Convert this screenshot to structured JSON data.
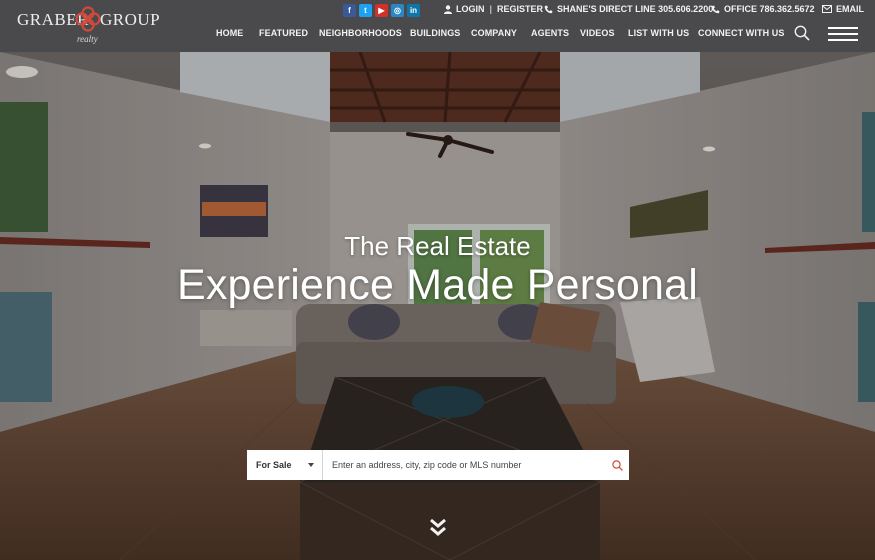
{
  "brand": {
    "left_word": "GRABER",
    "right_word": "GROUP",
    "tagline": "realty",
    "mark_color": "#d04a3b"
  },
  "social": [
    {
      "name": "facebook",
      "glyph": "f"
    },
    {
      "name": "twitter",
      "glyph": "t"
    },
    {
      "name": "youtube",
      "glyph": "▶"
    },
    {
      "name": "instagram",
      "glyph": "◎"
    },
    {
      "name": "linkedin",
      "glyph": "in"
    }
  ],
  "utility": {
    "login": "LOGIN",
    "register": "REGISTER",
    "separator": "|",
    "direct_line": "SHANE'S DIRECT LINE 305.606.2200",
    "office": "OFFICE 786.362.5672",
    "email": "EMAIL"
  },
  "nav": {
    "items": [
      "HOME",
      "FEATURED",
      "NEIGHBORHOODS",
      "BUILDINGS",
      "COMPANY",
      "AGENTS",
      "VIDEOS",
      "LIST WITH US",
      "CONNECT WITH US"
    ]
  },
  "hero": {
    "line1": "The Real Estate",
    "line2": "Experience Made Personal"
  },
  "search": {
    "type_selected": "For Sale",
    "placeholder": "Enter an address, city, zip code or MLS number",
    "value": "",
    "accent_color": "#d04a3b"
  },
  "colors": {
    "header_bg": "#4a4a4c"
  }
}
